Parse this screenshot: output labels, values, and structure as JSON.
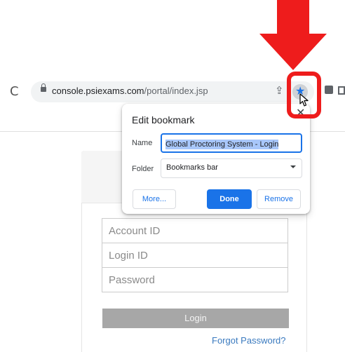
{
  "browser": {
    "url_host": "console.psiexams.com",
    "url_path": "/portal/index.jsp"
  },
  "bookmark_dialog": {
    "title": "Edit bookmark",
    "name_label": "Name",
    "name_value": "Global Proctoring System - Login",
    "folder_label": "Folder",
    "folder_value": "Bookmarks bar",
    "more_label": "More...",
    "done_label": "Done",
    "remove_label": "Remove",
    "close_glyph": "✕"
  },
  "login_form": {
    "account_placeholder": "Account ID",
    "login_placeholder": "Login ID",
    "password_placeholder": "Password",
    "login_button": "Login",
    "forgot_link": "Forgot Password?"
  },
  "icons": {
    "reload": "reload-icon",
    "lock": "lock-icon",
    "share": "share-icon",
    "star": "star-icon",
    "cursor": "cursor-icon",
    "extensions": "puzzle-icon",
    "window": "window-icon"
  },
  "colors": {
    "annotation_red": "#ee1c1c",
    "accent_blue": "#1a73e8",
    "selection_highlight": "#a8c7fa",
    "link_blue": "#3a7abf"
  }
}
